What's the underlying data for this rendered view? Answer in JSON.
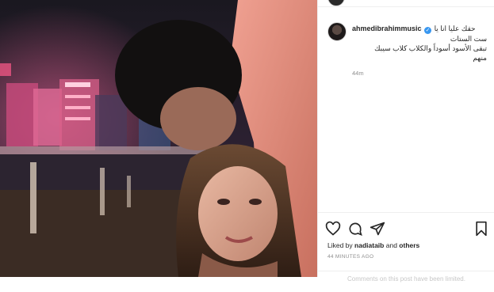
{
  "post": {
    "username": "ahmedibrahimmusic",
    "verified_mark": "✓",
    "caption_line1": "حقك عليا انا يا",
    "caption_line2": "ست الستات",
    "caption_line3": "تبقى الأسود أسوداً والكلاب كلاب سيبك",
    "caption_line4": "منهم",
    "comment_time": "44m",
    "liked_by_prefix": "Liked by",
    "liked_by_user": "nadiataib",
    "liked_by_joiner": "and",
    "liked_by_others": "others",
    "post_age": "44 MINUTES AGO",
    "comments_notice": "Comments on this post have been limited."
  },
  "icons": {
    "like": "heart-icon",
    "comment": "comment-icon",
    "share": "send-icon",
    "save": "bookmark-icon"
  },
  "colors": {
    "verified": "#3897f0",
    "text": "#262626",
    "muted": "#8e8e8e",
    "border": "#efefef"
  }
}
